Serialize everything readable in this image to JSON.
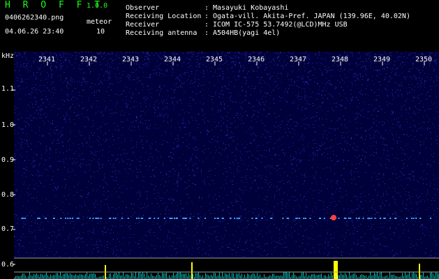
{
  "header": {
    "app_title": "H R O F F T",
    "version": "1.0.0",
    "filename": "0406262340.png",
    "datetime": "04.06.26 23:40",
    "meteor_label": "meteor",
    "meteor_count": "10"
  },
  "meta": [
    {
      "label": "Observer",
      "sep": ":",
      "value": "Masayuki Kobayashi"
    },
    {
      "label": "Receiving Location",
      "sep": ":",
      "value": "Ogata-vill. Akita-Pref. JAPAN (139.96E, 40.02N)"
    },
    {
      "label": "Receiver",
      "sep": ":",
      "value": "ICOM IC-575 53.7492(@LCD)MHz USB"
    },
    {
      "label": "Receiving antenna",
      "sep": ":",
      "value": "A504HB(yagi 4el)"
    }
  ],
  "chart_data": {
    "type": "heatmap",
    "ylabel": "kHz",
    "x_ticks": [
      "2341",
      "2342",
      "2343",
      "2344",
      "2345",
      "2346",
      "2347",
      "2348",
      "2349",
      "2350"
    ],
    "y_ticks": [
      "1.1",
      "1.0",
      "0.9",
      "0.8",
      "0.7",
      "0.6"
    ],
    "background_color": "#00003a",
    "noise_color": "#2020c0",
    "carrier_line_color": "#40a0ff",
    "spectrum_color": "#00c0c0",
    "meteor_color": "#ffff00",
    "echo_marker_color": "#ff4040"
  }
}
